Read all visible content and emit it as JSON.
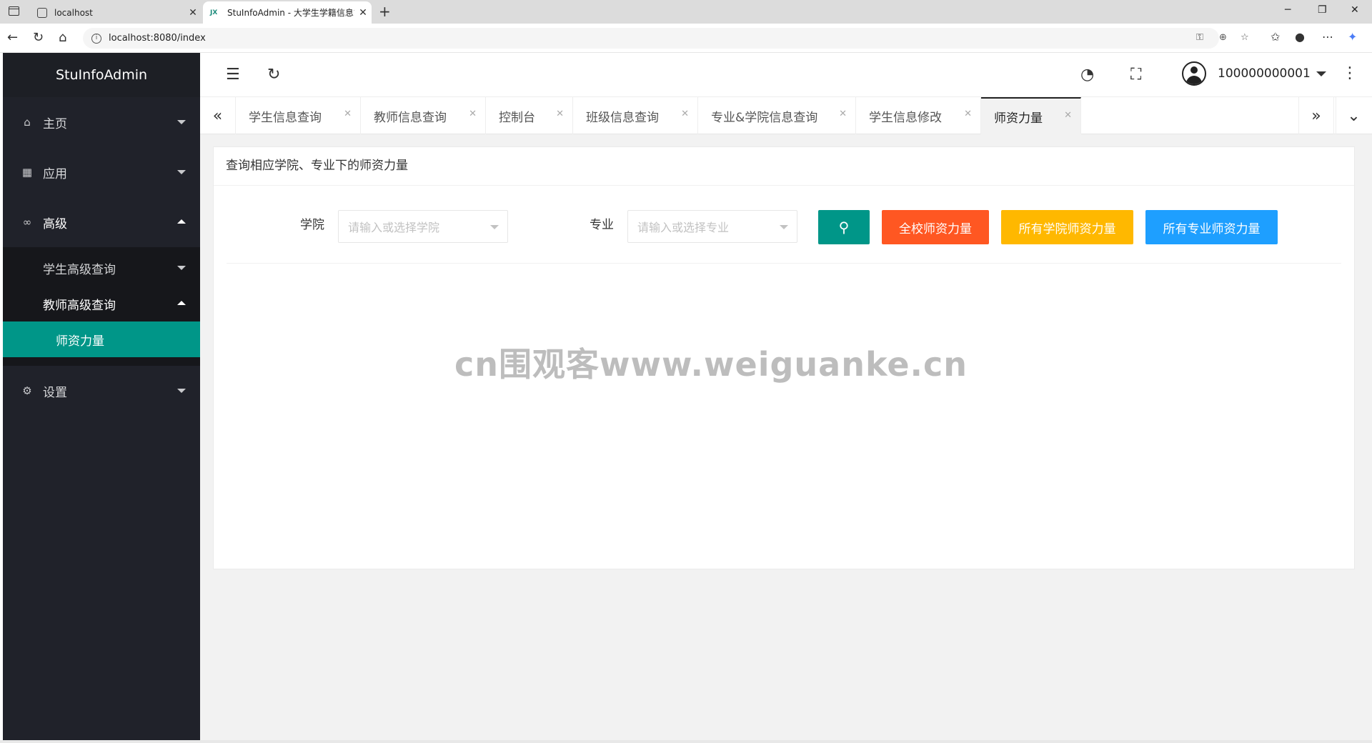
{
  "browser": {
    "tabs": [
      {
        "title": "localhost",
        "close": "✕"
      },
      {
        "title": "StuInfoAdmin - 大学生学籍信息管",
        "close": "✕",
        "favicon": "JX"
      }
    ],
    "new_tab": "+",
    "url": "localhost:8080/index",
    "window_controls": {
      "minimize": "─",
      "restore": "❐",
      "close": "✕"
    }
  },
  "sidebar": {
    "logo": "StuInfoAdmin",
    "items": [
      {
        "label": "主页",
        "icon": "home-icon"
      },
      {
        "label": "应用",
        "icon": "apps-icon"
      },
      {
        "label": "高级",
        "icon": "infinity-icon"
      },
      {
        "label": "设置",
        "icon": "gear-icon"
      }
    ],
    "advanced_sub": [
      {
        "label": "学生高级查询"
      },
      {
        "label": "教师高级查询"
      }
    ],
    "active_leaf": "师资力量"
  },
  "header": {
    "username": "100000000001"
  },
  "page_tabs": [
    {
      "label": "学生信息查询"
    },
    {
      "label": "教师信息查询"
    },
    {
      "label": "控制台"
    },
    {
      "label": "班级信息查询"
    },
    {
      "label": "专业&学院信息查询"
    },
    {
      "label": "学生信息修改"
    },
    {
      "label": "师资力量"
    }
  ],
  "main": {
    "card_title": "查询相应学院、专业下的师资力量",
    "college_label": "学院",
    "college_placeholder": "请输入或选择学院",
    "major_label": "专业",
    "major_placeholder": "请输入或选择专业",
    "btn_all_school": "全校师资力量",
    "btn_all_colleges": "所有学院师资力量",
    "btn_all_majors": "所有专业师资力量"
  },
  "watermark": "cn围观客www.weiguanke.cn",
  "colors": {
    "sidebar_bg": "#20222a",
    "active_green": "#009688",
    "search_btn": "#009688",
    "btn_orange_red": "#ff5722",
    "btn_orange": "#ffb800",
    "btn_blue": "#1e9fff"
  }
}
